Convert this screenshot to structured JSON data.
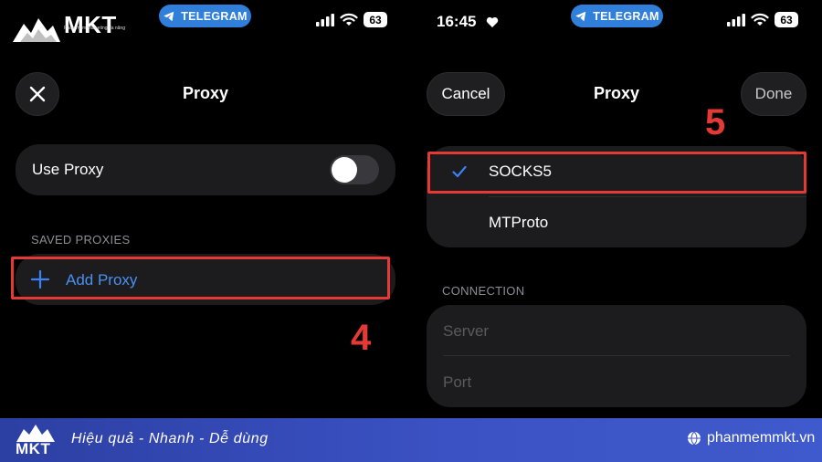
{
  "logo": {
    "brand": "MKT",
    "tagline": "Phần mềm Marketing đa năng"
  },
  "status": {
    "time": "16:45",
    "pill_label": "TELEGRAM",
    "battery": "63"
  },
  "left": {
    "nav_title": "Proxy",
    "use_proxy_label": "Use Proxy",
    "use_proxy_enabled": false,
    "saved_proxies_label": "SAVED PROXIES",
    "add_proxy_label": "Add Proxy",
    "step_label": "4"
  },
  "right": {
    "cancel_label": "Cancel",
    "nav_title": "Proxy",
    "done_label": "Done",
    "step_label": "5",
    "proxy_types": [
      {
        "label": "SOCKS5",
        "selected": true
      },
      {
        "label": "MTProto",
        "selected": false
      }
    ],
    "connection_label": "CONNECTION",
    "server_placeholder": "Server",
    "port_placeholder": "Port"
  },
  "footer": {
    "brand": "MKT",
    "slogan": "Hiệu quả - Nhanh  - Dễ dùng",
    "website": "phanmemmkt.vn"
  },
  "colors": {
    "accent_blue": "#3b82f6",
    "highlight_red": "#e53935",
    "card_bg": "#1c1c1e",
    "footer_bg": "#3b52c4"
  }
}
